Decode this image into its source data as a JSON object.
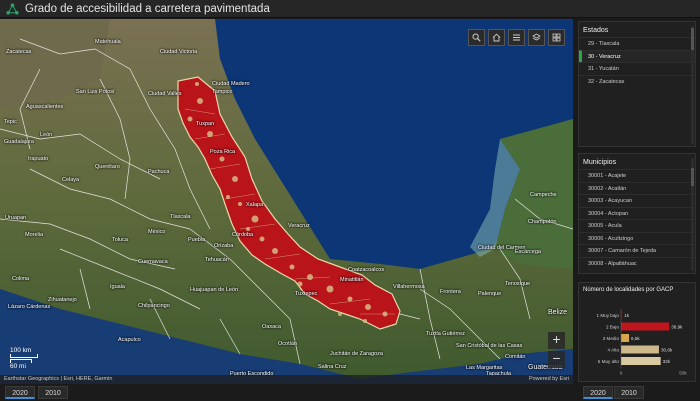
{
  "app": {
    "title": "Grado de accesibilidad a carretera pavimentada"
  },
  "map": {
    "labels": [
      {
        "id": "ciudad-madero",
        "text": "Ciudad Madero"
      },
      {
        "id": "tampico",
        "text": "Tampico"
      },
      {
        "id": "ciudad-valles",
        "text": "Ciudad Valles"
      },
      {
        "id": "tuxpan",
        "text": "Tuxpan"
      },
      {
        "id": "poza-rica",
        "text": "Poza Rica"
      },
      {
        "id": "veracruz",
        "text": "Veracruz"
      },
      {
        "id": "xalapa",
        "text": "Xalapa"
      },
      {
        "id": "villahermosa",
        "text": "Villahermosa"
      },
      {
        "id": "campeche",
        "text": "Campeche"
      },
      {
        "id": "ciudad-del-carmen",
        "text": "Ciudad del Carmen"
      },
      {
        "id": "escarcega",
        "text": "Escárcega"
      },
      {
        "id": "champoton",
        "text": "Champotón"
      },
      {
        "id": "frontera",
        "text": "Frontera"
      },
      {
        "id": "oaxaca",
        "text": "Oaxaca"
      },
      {
        "id": "tuxtla",
        "text": "Tuxtla Gutiérrez"
      },
      {
        "id": "juchitan",
        "text": "Juchitán de Zaragoza"
      },
      {
        "id": "salina-cruz",
        "text": "Salina Cruz"
      },
      {
        "id": "tapachula",
        "text": "Tapachula"
      },
      {
        "id": "acapulco",
        "text": "Acapulco"
      },
      {
        "id": "chilpancingo",
        "text": "Chilpancingo"
      },
      {
        "id": "puebla",
        "text": "Puebla"
      },
      {
        "id": "mexico",
        "text": "México"
      },
      {
        "id": "queretaro",
        "text": "Querétaro"
      },
      {
        "id": "toluca",
        "text": "Toluca"
      },
      {
        "id": "morelia",
        "text": "Morelia"
      },
      {
        "id": "san-luis-potosi",
        "text": "San Luis Potosí"
      },
      {
        "id": "zacatecas",
        "text": "Zacatecas"
      },
      {
        "id": "aguascalientes",
        "text": "Aguascalientes"
      },
      {
        "id": "guadalajara",
        "text": "Guadalajara"
      },
      {
        "id": "irapuato",
        "text": "Irapuato"
      },
      {
        "id": "colima",
        "text": "Colima"
      },
      {
        "id": "zihuatanejo",
        "text": "Zihuatanejo"
      },
      {
        "id": "pachuca",
        "text": "Pachuca"
      },
      {
        "id": "tlaxcala",
        "text": "Tlaxcala"
      },
      {
        "id": "cuernavaca",
        "text": "Cuernavaca"
      },
      {
        "id": "tehuacan",
        "text": "Tehuacán"
      },
      {
        "id": "celaya",
        "text": "Celaya"
      },
      {
        "id": "leon",
        "text": "León"
      },
      {
        "id": "uruapan",
        "text": "Uruapan"
      },
      {
        "id": "san-cristobal",
        "text": "San Cristóbal de las Casas"
      },
      {
        "id": "coatzacoalcos",
        "text": "Coatzacoalcos"
      },
      {
        "id": "minatitlan",
        "text": "Minatitlán"
      },
      {
        "id": "cordoba",
        "text": "Córdoba"
      },
      {
        "id": "orizaba",
        "text": "Orizaba"
      },
      {
        "id": "ciudad-victoria",
        "text": "Ciudad Victoria"
      },
      {
        "id": "matehuala",
        "text": "Matehuala"
      },
      {
        "id": "tepic",
        "text": "Tepic"
      },
      {
        "id": "lazaro-cardenas",
        "text": "Lázaro Cárdenas"
      },
      {
        "id": "iguala",
        "text": "Iguala"
      },
      {
        "id": "tuxtepec",
        "text": "Tuxtepec"
      },
      {
        "id": "comitan",
        "text": "Comitán"
      },
      {
        "id": "huajuapan",
        "text": "Huajuapan de León"
      },
      {
        "id": "puerto-escondido",
        "text": "Puerto Escondido"
      },
      {
        "id": "ocotlan",
        "text": "Ocotlán"
      },
      {
        "id": "tenosique",
        "text": "Tenosique"
      },
      {
        "id": "palenque",
        "text": "Palenque"
      },
      {
        "id": "las-margaritas",
        "text": "Las Margaritas"
      },
      {
        "id": "guatemala",
        "text": "Guatemala"
      },
      {
        "id": "belize",
        "text": "Belize"
      }
    ],
    "scale": {
      "km": "100 km",
      "mi": "60 mi"
    },
    "attribution": "Earthstar Geographics | Esri, HERE, Garmin",
    "powered_by": "Powered by Esri",
    "zoom_in": "+",
    "zoom_out": "−"
  },
  "estados": {
    "title": "Estados",
    "items": [
      "29 - Tlaxcala",
      "30 - Veracruz",
      "31 - Yucatán",
      "32 - Zacatecas"
    ],
    "selected_index": 1
  },
  "municipios": {
    "title": "Municipios",
    "items": [
      "30001 - Acajete",
      "30002 - Acatlán",
      "30003 - Acayucan",
      "30004 - Actopan",
      "30005 - Acula",
      "30006 - Acultzingo",
      "30007 - Camarón de Tejeda",
      "30008 - Alpatláhuac"
    ]
  },
  "chart_data": {
    "type": "bar",
    "orientation": "horizontal",
    "title": "Número de localidades por GACP",
    "categories": [
      "1 Muy bajo",
      "2 Bajo",
      "3 Medio",
      "4 Alto",
      "5 Muy alto"
    ],
    "values": [
      1000,
      38900,
      6500,
      30600,
      32000
    ],
    "data_labels": [
      "1k",
      "38,9k",
      "6,5k",
      "30,6k",
      "32k"
    ],
    "colors": [
      "#8b0000",
      "#c0161e",
      "#d6a84a",
      "#cdb98a",
      "#d8c99f"
    ],
    "xlim": [
      0,
      50000
    ],
    "xticks": [
      "0",
      "50k"
    ]
  },
  "years": {
    "left": [
      "2020",
      "2010"
    ],
    "right": [
      "2020",
      "2010"
    ],
    "active": "2020"
  },
  "colors": {
    "accent_green": "#2aa84a",
    "accent_blue": "#3c8fd8",
    "veracruz_red": "#b8141a"
  }
}
